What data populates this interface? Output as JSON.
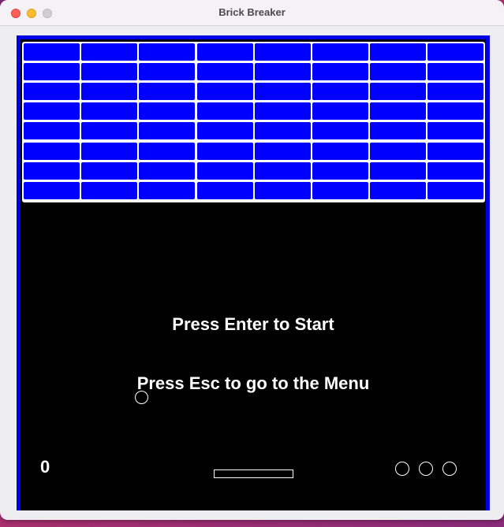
{
  "window": {
    "title": "Brick Breaker"
  },
  "game": {
    "score": "0",
    "start_message": "Press Enter to Start",
    "menu_message": "Press Esc to go to the Menu",
    "brick_rows": 8,
    "brick_columns": 8,
    "lives": 3
  },
  "colors": {
    "frame": "#0000e6",
    "brick": "#0000ff",
    "background": "#000000",
    "text": "#ffffff"
  }
}
